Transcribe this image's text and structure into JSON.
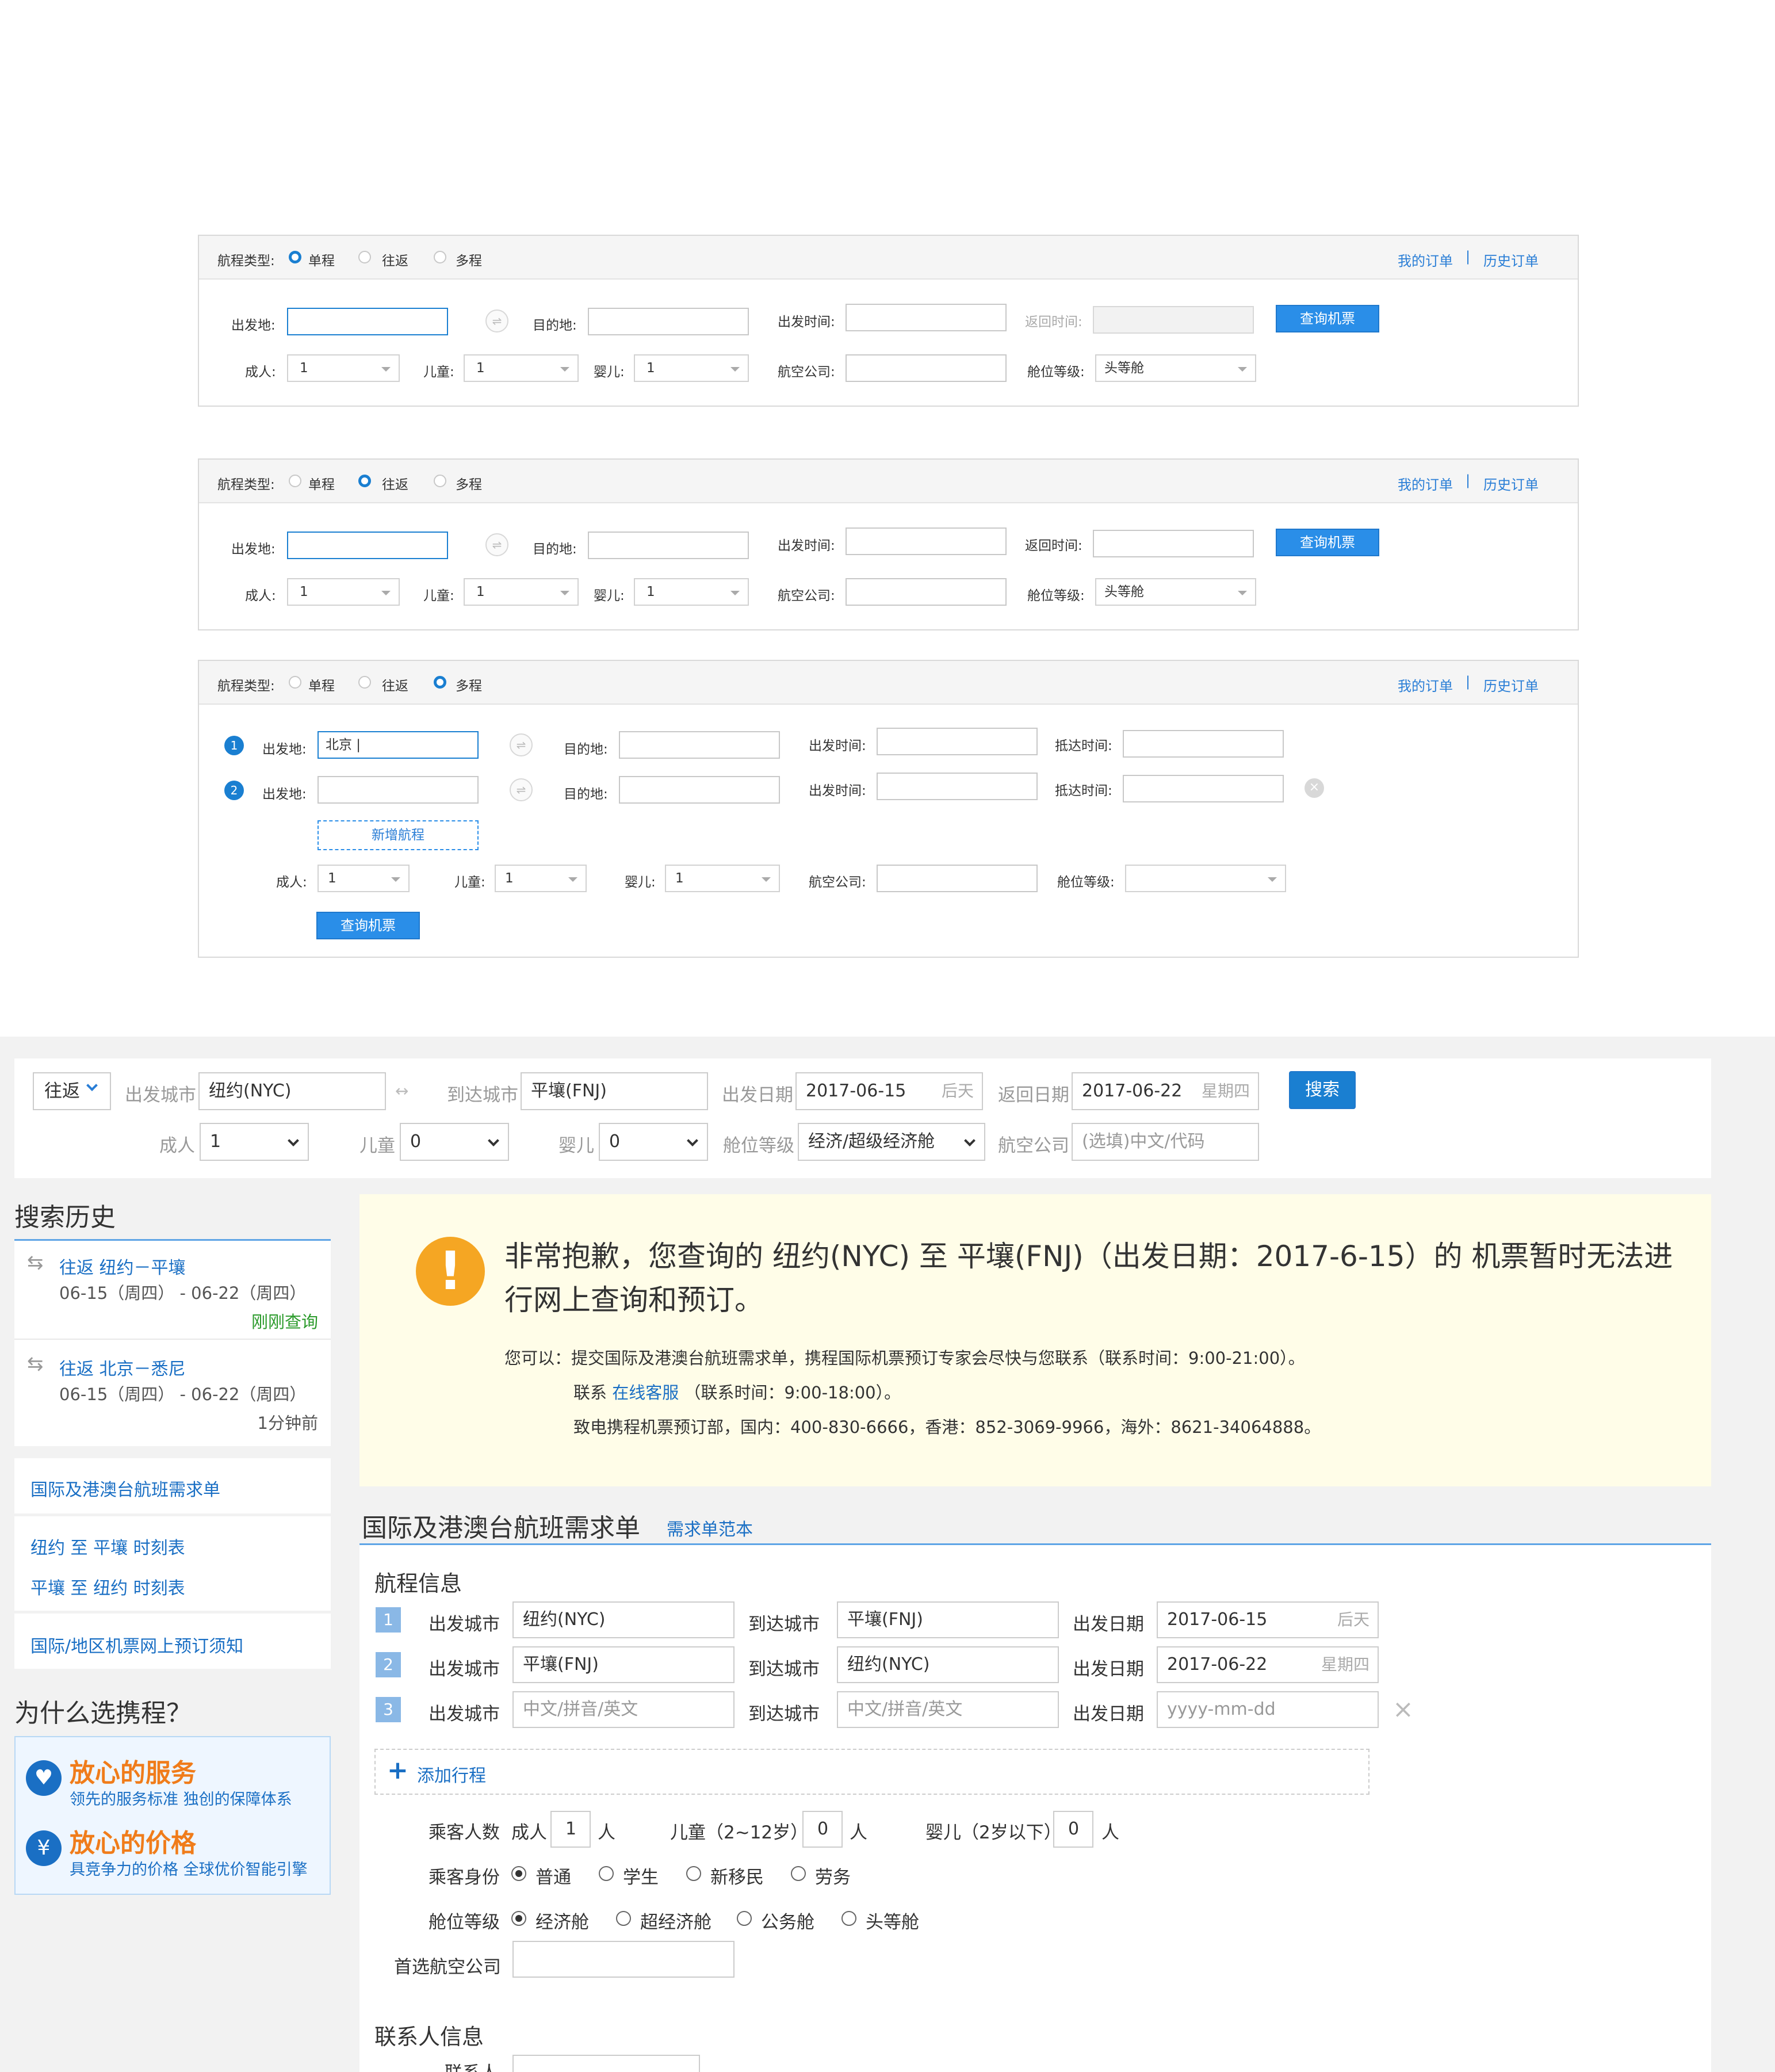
{
  "panels": [
    {
      "trip_type_label": "航程类型:",
      "options": [
        "单程",
        "往返",
        "多程"
      ],
      "selected": 0,
      "my_orders": "我的订单",
      "sep": "|",
      "history_orders": "历史订单",
      "from_label": "出发地:",
      "to_label": "目的地:",
      "depart_label": "出发时间:",
      "return_label": "返回时间:",
      "search_btn": "查询机票",
      "adult_label": "成人:",
      "adult_val": "1",
      "child_label": "儿童:",
      "child_val": "1",
      "infant_label": "婴儿:",
      "infant_val": "1",
      "airline_label": "航空公司:",
      "cabin_label": "舱位等级:",
      "cabin_val": "头等舱"
    },
    {
      "trip_type_label": "航程类型:",
      "options": [
        "单程",
        "往返",
        "多程"
      ],
      "selected": 1,
      "my_orders": "我的订单",
      "sep": "|",
      "history_orders": "历史订单",
      "from_label": "出发地:",
      "to_label": "目的地:",
      "depart_label": "出发时间:",
      "return_label": "返回时间:",
      "search_btn": "查询机票",
      "adult_label": "成人:",
      "adult_val": "1",
      "child_label": "儿童:",
      "child_val": "1",
      "infant_label": "婴儿:",
      "infant_val": "1",
      "airline_label": "航空公司:",
      "cabin_label": "舱位等级:",
      "cabin_val": "头等舱"
    },
    {
      "trip_type_label": "航程类型:",
      "options": [
        "单程",
        "往返",
        "多程"
      ],
      "selected": 2,
      "my_orders": "我的订单",
      "sep": "|",
      "history_orders": "历史订单",
      "from_label": "出发地:",
      "from_val": "北京",
      "to_label": "目的地:",
      "depart_label": "出发时间:",
      "arrive_label": "抵达时间:",
      "add_leg": "新增航程",
      "adult_label": "成人:",
      "adult_val": "1",
      "child_label": "儿童:",
      "child_val": "1",
      "infant_label": "婴儿:",
      "infant_val": "1",
      "airline_label": "航空公司:",
      "cabin_label": "舱位等级:",
      "search_btn": "查询机票",
      "leg_nums": [
        "1",
        "2"
      ]
    }
  ],
  "searchbar": {
    "trip_type": "往返",
    "from_label": "出发城市",
    "from_val": "纽约(NYC)",
    "to_label": "到达城市",
    "to_val": "平壤(FNJ)",
    "depart_label": "出发日期",
    "depart_val": "2017-06-15",
    "depart_hint": "后天",
    "return_label": "返回日期",
    "return_val": "2017-06-22",
    "return_hint": "星期四",
    "search_btn": "搜索",
    "adult_label": "成人",
    "adult_val": "1",
    "child_label": "儿童",
    "child_val": "0",
    "infant_label": "婴儿",
    "infant_val": "0",
    "cabin_label": "舱位等级",
    "cabin_val": "经济/超级经济舱",
    "airline_label": "航空公司",
    "airline_placeholder": "(选填)中文/代码"
  },
  "sidebar": {
    "history_title": "搜索历史",
    "history": [
      {
        "route": "往返 纽约－平壤",
        "dates": "06-15（周四） - 06-22（周四）",
        "time": "刚刚查询"
      },
      {
        "route": "往返 北京－悉尼",
        "dates": "06-15（周四） - 06-22（周四）",
        "time": "1分钟前"
      }
    ],
    "links1": [
      "国际及港澳台航班需求单"
    ],
    "links2": [
      "纽约 至 平壤 时刻表",
      "平壤 至 纽约 时刻表"
    ],
    "links3": [
      "国际/地区机票网上预订须知"
    ],
    "why_title": "为什么选携程？",
    "promo": [
      {
        "title": "放心的服务",
        "sub": "领先的服务标准 独创的保障体系",
        "icon": "heart-icon"
      },
      {
        "title": "放心的价格",
        "sub": "具竞争力的价格 全球优价智能引擎",
        "icon": "yen-icon"
      }
    ]
  },
  "notice": {
    "icon_glyph": "!",
    "line1": "非常抱歉，您查询的 纽约(NYC) 至 平壤(FNJ)（出发日期：2017-6-15）的 机票暂时无法进",
    "line2": "行网上查询和预订。",
    "p1": "您可以：提交国际及港澳台航班需求单，携程国际机票预订专家会尽快与您联系（联系时间：9:00-21:00）。",
    "p2_pre": "联系",
    "p2_link": "在线客服",
    "p2_post": "（联系时间：9:00-18:00）。",
    "p3": "致电携程机票预订部，国内：400-830-6666，香港：852-3069-9966，海外：8621-34064888。"
  },
  "form": {
    "title": "国际及港澳台航班需求单",
    "sample_link": "需求单范本",
    "itinerary_title": "航程信息",
    "from_label": "出发城市",
    "to_label": "到达城市",
    "date_label": "出发日期",
    "legs": [
      {
        "n": "1",
        "from": "纽约(NYC)",
        "to": "平壤(FNJ)",
        "date": "2017-06-15",
        "hint": "后天"
      },
      {
        "n": "2",
        "from": "平壤(FNJ)",
        "to": "纽约(NYC)",
        "date": "2017-06-22",
        "hint": "星期四"
      },
      {
        "n": "3",
        "from": "中文/拼音/英文",
        "to": "中文/拼音/英文",
        "date": "yyyy-mm-dd",
        "hint": ""
      }
    ],
    "remove_glyph": "×",
    "add_glyph": "+",
    "add_label": "添加行程",
    "pax_label": "乘客人数",
    "adult_label": "成人",
    "adult_val": "1",
    "child_label": "儿童（2~12岁）",
    "child_val": "0",
    "infant_label": "婴儿（2岁以下）",
    "infant_val": "0",
    "unit": "人",
    "identity_label": "乘客身份",
    "identities": [
      "普通",
      "学生",
      "新移民",
      "劳务"
    ],
    "cabin_label": "舱位等级",
    "cabins": [
      "经济舱",
      "超经济舱",
      "公务舱",
      "头等舱"
    ],
    "airline_label": "首选航空公司",
    "contact_title": "联系人信息",
    "contact_label": "联系人"
  }
}
